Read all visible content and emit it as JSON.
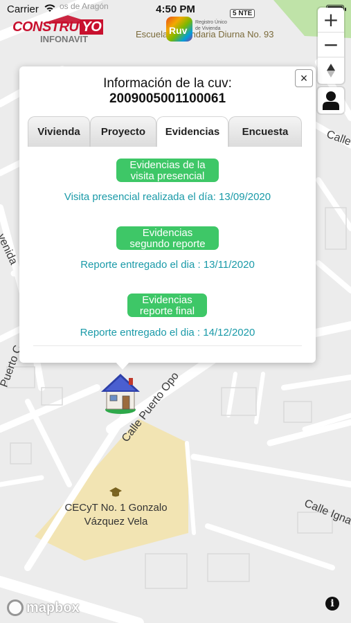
{
  "status_bar": {
    "carrier": "Carrier",
    "time": "4:50 PM"
  },
  "logos": {
    "construyo": {
      "main": "CONSTRU",
      "yo": "YO",
      "sub": "INFONAVIT"
    },
    "ruv": {
      "mark": "Ruv",
      "description": "Registro Único de Vivienda"
    }
  },
  "map": {
    "labels": {
      "school_top": "Escuela Secundaria Diurna No. 93",
      "highway_badge": "5 NTE",
      "street_puerto_opo": "Calle Puerto Opo",
      "street_puerto_c": "Puerto C",
      "street_avenida": "venida",
      "street_calle_right": "Calle",
      "street_ignacio": "Calle Igna",
      "top_left_fragment": "os de Aragón"
    },
    "school": {
      "name_line1": "CECyT No. 1 Gonzalo",
      "name_line2": "Vázquez Vela"
    },
    "colors": {
      "background": "#ececec",
      "road": "#ffffff",
      "park": "#f2e4b3",
      "green": "#b8e0a0"
    }
  },
  "controls": {
    "zoom_in": "+",
    "zoom_out": "−"
  },
  "popup": {
    "title_line1": "Información de la cuv:",
    "title_line2": "2009005001100061",
    "close": "×",
    "tabs": [
      {
        "label": "Vivienda"
      },
      {
        "label": "Proyecto"
      },
      {
        "label": "Evidencias"
      },
      {
        "label": "Encuesta"
      }
    ],
    "active_tab": "Evidencias",
    "sections": [
      {
        "button_line1": "Evidencias de la",
        "button_line2": "visita presencial",
        "info": "Visita presencial realizada el día: 13/09/2020"
      },
      {
        "button_line1": "Evidencias",
        "button_line2": "segundo reporte",
        "info": "Reporte entregado el dia : 13/11/2020"
      },
      {
        "button_line1": "Evidencias",
        "button_line2": "reporte final",
        "info": "Reporte entregado el dia : 14/12/2020"
      }
    ],
    "colors": {
      "button": "#3ec767",
      "info_text": "#1a9aa8"
    }
  },
  "footer": {
    "mapbox": "mapbox",
    "info": "i"
  }
}
